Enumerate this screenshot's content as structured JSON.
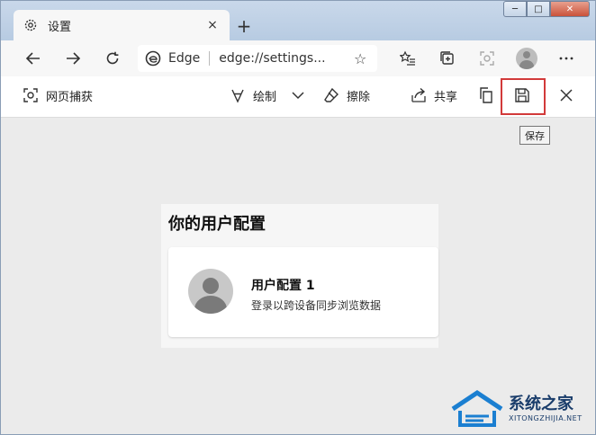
{
  "tab": {
    "title": "设置",
    "close": "×",
    "new_tab": "+"
  },
  "window_controls": {
    "minimize": "─",
    "maximize": "□",
    "close": "✕"
  },
  "address_bar": {
    "brand": "Edge",
    "url": "edge://settings...",
    "favorite": "☆"
  },
  "capture_toolbar": {
    "web_capture": "网页捕获",
    "draw": "绘制",
    "erase": "擦除",
    "share": "共享",
    "save_tooltip": "保存"
  },
  "content": {
    "heading": "你的用户配置",
    "profile_name": "用户配置 1",
    "profile_desc": "登录以跨设备同步浏览数据"
  },
  "watermark": {
    "title": "系统之家",
    "subtitle": "XITONGZHIJIA.NET"
  },
  "colors": {
    "highlight": "#d23a3a",
    "window_bg": "#ebebeb",
    "titlebar": "#b7cbe2"
  }
}
